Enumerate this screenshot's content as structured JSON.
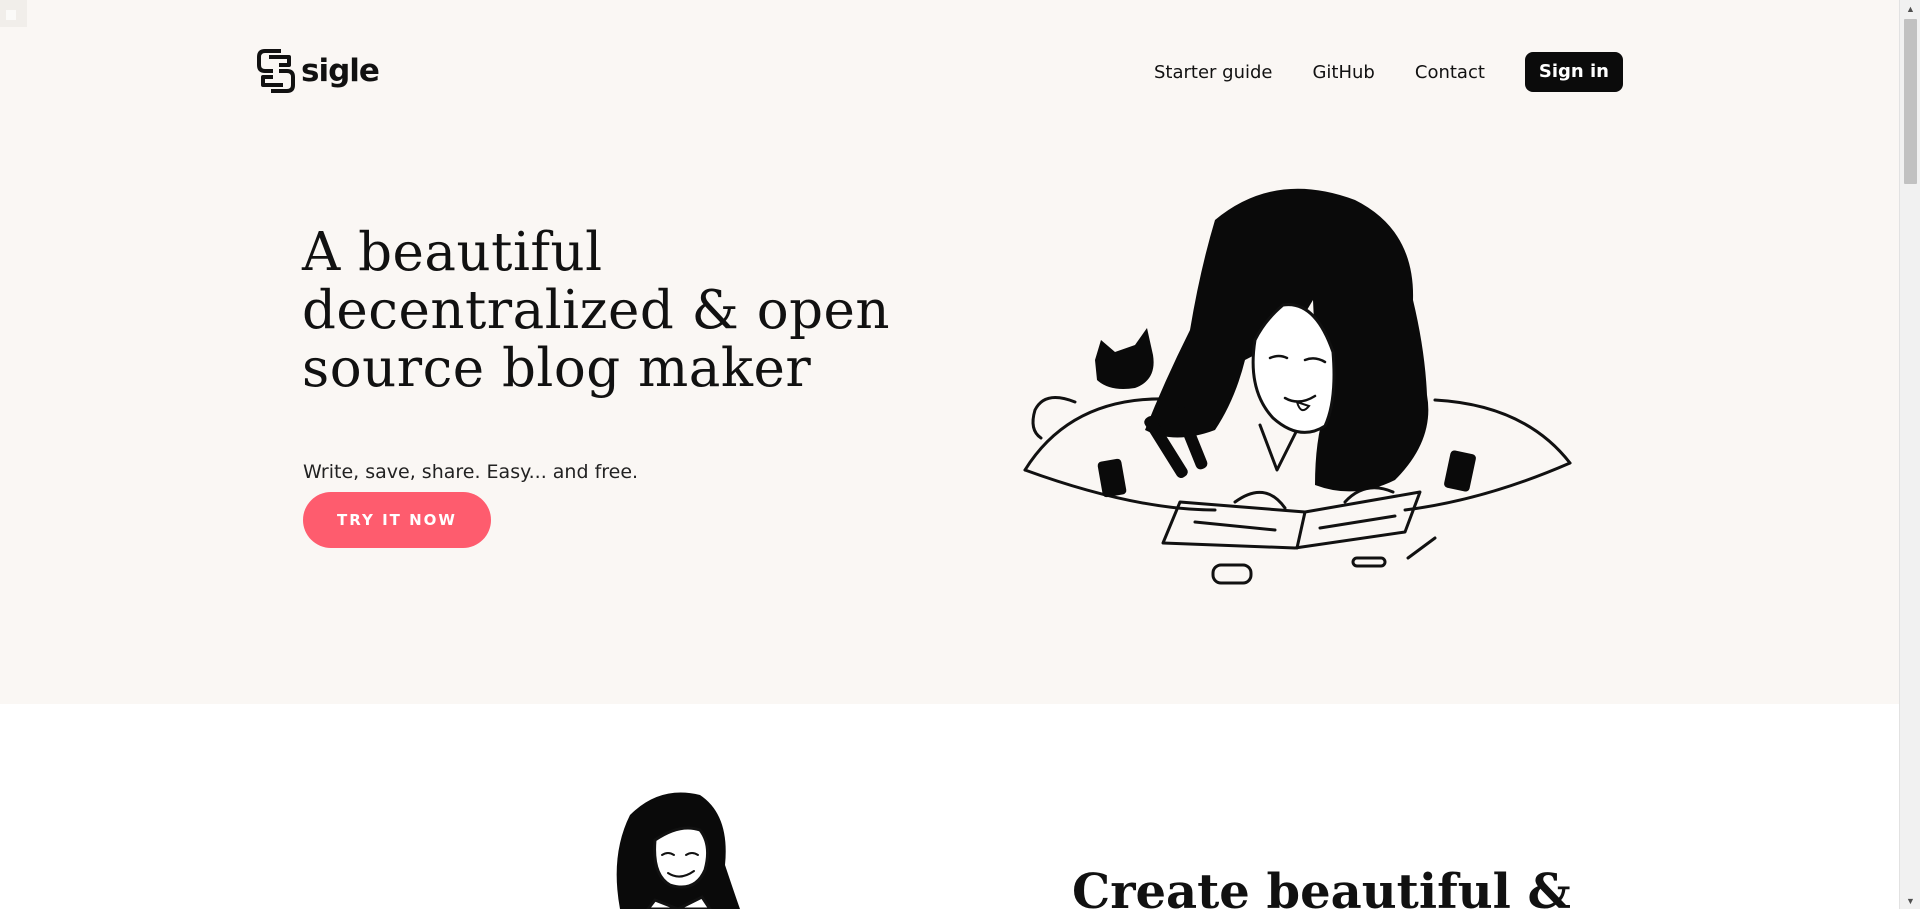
{
  "brand": {
    "name": "sigle",
    "logo_icon": "sigle-logo-icon"
  },
  "nav": {
    "links": [
      "Starter guide",
      "GitHub",
      "Contact"
    ],
    "signin_label": "Sign in"
  },
  "hero": {
    "title": "A beautiful decentralized & open source blog maker",
    "subtitle": "Write, save, share. Easy... and free.",
    "cta_label": "TRY IT NOW",
    "illustration": "girl-writing-with-cat-illustration"
  },
  "section2": {
    "title": "Create beautiful &",
    "illustration": "girl-smiling-illustration"
  },
  "colors": {
    "hero_bg": "#faf7f4",
    "cta": "#fe5c6e",
    "signin_bg": "#0b0b0b",
    "text": "#111111"
  },
  "scrollbar": {
    "up_icon": "scroll-up-arrow-icon",
    "down_icon": "scroll-down-arrow-icon"
  }
}
